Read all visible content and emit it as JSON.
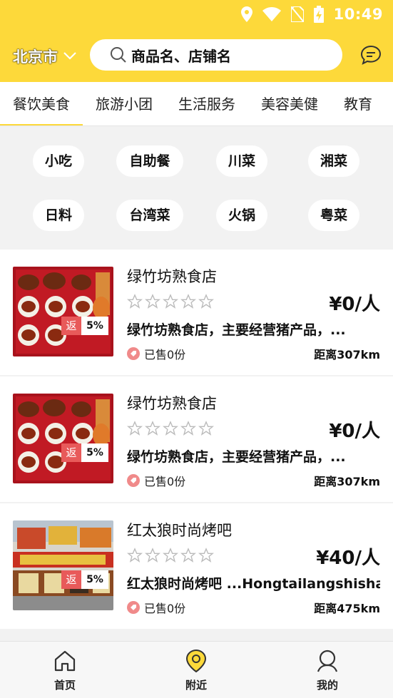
{
  "status_bar": {
    "time": "10:49"
  },
  "header": {
    "city": "北京市",
    "search_placeholder": "商品名、店铺名"
  },
  "tabs": [
    {
      "label": "餐饮美食",
      "active": true
    },
    {
      "label": "旅游小团"
    },
    {
      "label": "生活服务"
    },
    {
      "label": "美容美健"
    },
    {
      "label": "教育"
    }
  ],
  "subcategories": [
    "小吃",
    "自助餐",
    "川菜",
    "湘菜",
    "日料",
    "台湾菜",
    "火锅",
    "粤菜"
  ],
  "listings": [
    {
      "name": "绿竹坊熟食店",
      "rating": 0,
      "price": "¥0/人",
      "description": "绿竹坊熟食店，主要经营猪产品，...",
      "sold": "已售0份",
      "distance": "距离307km",
      "rebate_label": "返",
      "rebate_pct": "5%"
    },
    {
      "name": "绿竹坊熟食店",
      "rating": 0,
      "price": "¥0/人",
      "description": "绿竹坊熟食店，主要经营猪产品，...",
      "sold": "已售0份",
      "distance": "距离307km",
      "rebate_label": "返",
      "rebate_pct": "5%"
    },
    {
      "name": "红太狼时尚烤吧",
      "rating": 0,
      "price": "¥40/人",
      "description": "红太狼时尚烤吧 ...Hongtailangshishan",
      "sold": "已售0份",
      "distance": "距离475km",
      "rebate_label": "返",
      "rebate_pct": "5%"
    }
  ],
  "bottom_nav": [
    {
      "label": "首页",
      "icon": "home-icon"
    },
    {
      "label": "附近",
      "icon": "location-pin-icon",
      "active": true
    },
    {
      "label": "我的",
      "icon": "user-icon"
    }
  ],
  "colors": {
    "brand_yellow": "#fdd93a",
    "rebate_red": "#e85a5a"
  }
}
